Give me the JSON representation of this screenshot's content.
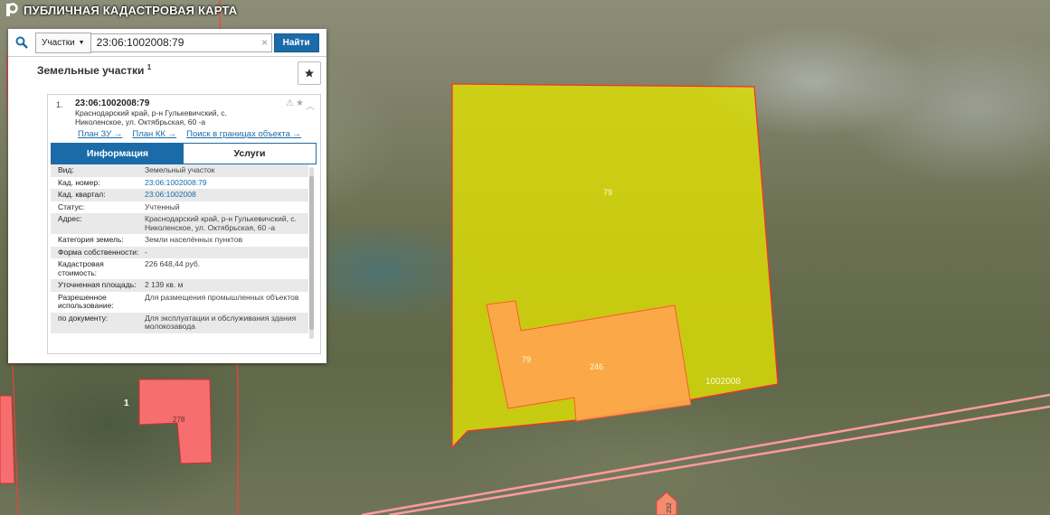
{
  "app": {
    "title": "ПУБЛИЧНАЯ КАДАСТРОВАЯ КАРТА"
  },
  "search": {
    "scope": "Участки",
    "value": "23:06:1002008:79",
    "button": "Найти"
  },
  "section": {
    "title": "Земельные участки",
    "count": "1"
  },
  "result": {
    "index": "1.",
    "cad_number": "23:06:1002008:79",
    "address": "Краснодарский край, р-н Гулькевичский, с. Николенское, ул. Октябрьская, 60 -а",
    "links": [
      "План ЗУ →",
      "План КК →",
      "Поиск в границах объекта →"
    ],
    "tabs": [
      "Информация",
      "Услуги"
    ],
    "fields": [
      {
        "k": "Вид:",
        "v": "Земельный участок"
      },
      {
        "k": "Кад. номер:",
        "v": "23:06:1002008:79"
      },
      {
        "k": "Кад. квартал:",
        "v": "23:06:1002008"
      },
      {
        "k": "Статус:",
        "v": "Учтенный"
      },
      {
        "k": "Адрес:",
        "v": "Краснодарский край, р-н Гулькевичский, с. Николенское, ул. Октябрьская, 60 -а"
      },
      {
        "k": "Категория земель:",
        "v": "Земли населённых пунктов"
      },
      {
        "k": "Форма собственности:",
        "v": "-"
      },
      {
        "k": "Кадастровая стоимость:",
        "v": "226 648,44 руб."
      },
      {
        "k": "Уточненная площадь:",
        "v": "2 139 кв. м"
      },
      {
        "k": "Разрешенное использование:",
        "v": "Для размещения промышленных объектов"
      },
      {
        "k": "по документу:",
        "v": "Для эксплуатации и обслуживания здания молокозавода"
      }
    ]
  },
  "map": {
    "parcel_label": "79",
    "building_label": "79",
    "building_code": "246",
    "quarter_label": "1002008",
    "left_parcel_num": "1",
    "left_parcel_code": "278",
    "bottom_code": "232",
    "colors": {
      "parcel": "#e3e600",
      "building": "#ffa64d",
      "left_parcel": "#ff6f72",
      "border": "#ff2b2b"
    }
  }
}
